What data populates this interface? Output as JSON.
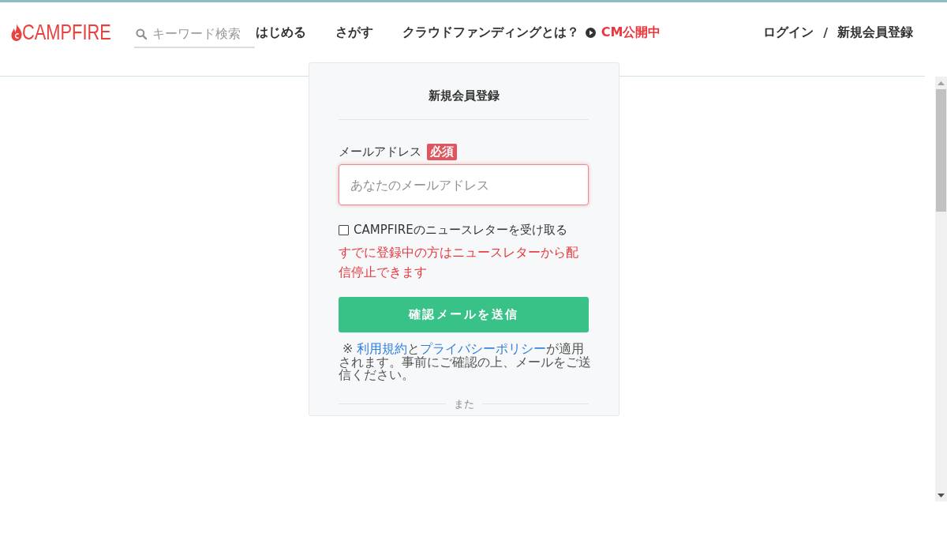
{
  "header": {
    "logo": "CAMPFIRE",
    "search": {
      "placeholder": "キーワード検索"
    },
    "nav": [
      {
        "label": "はじめる",
        "kind": "link"
      },
      {
        "label": "さがす",
        "kind": "link"
      },
      {
        "label": "クラウドファンディングとは？",
        "kind": "link"
      },
      {
        "label": "CM公開中",
        "kind": "video"
      }
    ],
    "account": [
      {
        "label": "ログイン",
        "kind": "link"
      },
      {
        "label": "/",
        "kind": "separator"
      },
      {
        "label": "新規会員登録",
        "kind": "link"
      }
    ]
  },
  "form": {
    "title": "新規会員登録",
    "email": {
      "label": "メールアドレス",
      "badge": "必須",
      "placeholder": "あなたのメールアドレス",
      "focused": true
    },
    "newsletter": {
      "label": "CAMPFIREのニュースレターを受け取る",
      "checked": false
    },
    "note": "すでに登録中の方はニュースレターから配信停止できます",
    "submit": "確認メールを送信",
    "terms": [
      {
        "kind": "text",
        "text": "※ "
      },
      {
        "kind": "link",
        "text": "利用規約"
      },
      {
        "kind": "text",
        "text": "と"
      },
      {
        "kind": "link",
        "text": "プライバシーポリシー"
      },
      {
        "kind": "text",
        "text": "が適用されます。事前にご確認の上、メールをご送信ください。"
      }
    ],
    "divider": "また"
  }
}
